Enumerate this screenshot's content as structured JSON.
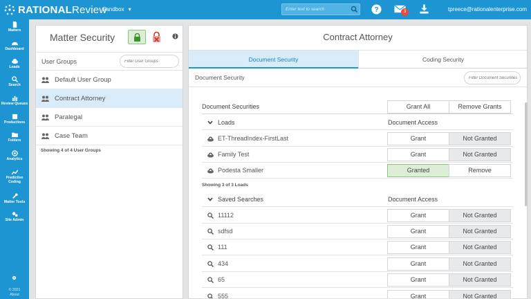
{
  "app": {
    "logo_bold": "RATIONAL",
    "logo_light": "Review",
    "project": "Sandbox",
    "project_caret": "▾",
    "search_placeholder": "Enter text to search",
    "mail_count": "3",
    "user_email": "tpreece@rationalenterprise.com"
  },
  "sidebar": {
    "items": [
      {
        "label": "Matters",
        "icon": "document-icon"
      },
      {
        "label": "Dashboard",
        "icon": "dashboard-icon"
      },
      {
        "label": "Loads",
        "icon": "cloud-upload-icon"
      },
      {
        "label": "Search",
        "icon": "search-icon"
      },
      {
        "label": "Review Queues",
        "icon": "bar-chart-icon"
      },
      {
        "label": "Productions",
        "icon": "production-icon"
      },
      {
        "label": "Folders",
        "icon": "folder-icon"
      },
      {
        "label": "Analytics",
        "icon": "analytics-icon"
      },
      {
        "label": "Predictive Coding",
        "icon": "line-chart-icon"
      },
      {
        "label": "Matter Tools",
        "icon": "wrench-icon"
      },
      {
        "label": "Site Admin",
        "icon": "gears-icon"
      }
    ],
    "copyright_year": "© 2021",
    "about": "About"
  },
  "matter_security": {
    "title": "Matter Security",
    "user_groups_label": "User Groups",
    "filter_placeholder": "Filter User Groups",
    "groups": [
      {
        "label": "Default User Group"
      },
      {
        "label": "Contract Attorney"
      },
      {
        "label": "Paralegal"
      },
      {
        "label": "Case Team"
      }
    ],
    "count_text": "Showing 4 of 4 User Groups"
  },
  "detail": {
    "title": "Contract Attorney",
    "tabs": [
      {
        "label": "Document Security"
      },
      {
        "label": "Coding Security"
      }
    ],
    "subheader": "Document Security",
    "filter_placeholder": "Filter Document Securities",
    "securities_label": "Document Securities",
    "grant_all": "Grant All",
    "remove_grants": "Remove Grants",
    "loads": {
      "label": "Loads",
      "access_label": "Document Access",
      "items": [
        {
          "label": "ET-ThreadIndex-FirstLast",
          "a": "Grant",
          "b": "Not Granted",
          "granted": false
        },
        {
          "label": "Family Test",
          "a": "Grant",
          "b": "Not Granted",
          "granted": false
        },
        {
          "label": "Podesta Smaller",
          "a": "Granted",
          "b": "Remove",
          "granted": true
        }
      ],
      "count_text": "Showing 3 of 3 Loads"
    },
    "saved_searches": {
      "label": "Saved Searches",
      "access_label": "Document Access",
      "items": [
        {
          "label": "11112",
          "a": "Grant",
          "b": "Not Granted"
        },
        {
          "label": "sdfsd",
          "a": "Grant",
          "b": "Not Granted"
        },
        {
          "label": "111",
          "a": "Grant",
          "b": "Not Granted"
        },
        {
          "label": "434",
          "a": "Grant",
          "b": "Not Granted"
        },
        {
          "label": "65",
          "a": "Grant",
          "b": "Not Granted"
        },
        {
          "label": "555",
          "a": "Grant",
          "b": "Not Granted"
        }
      ]
    }
  },
  "colors": {
    "brand": "#1e95d3",
    "selected": "#d8ebf8",
    "granted": "#dcefd6"
  }
}
